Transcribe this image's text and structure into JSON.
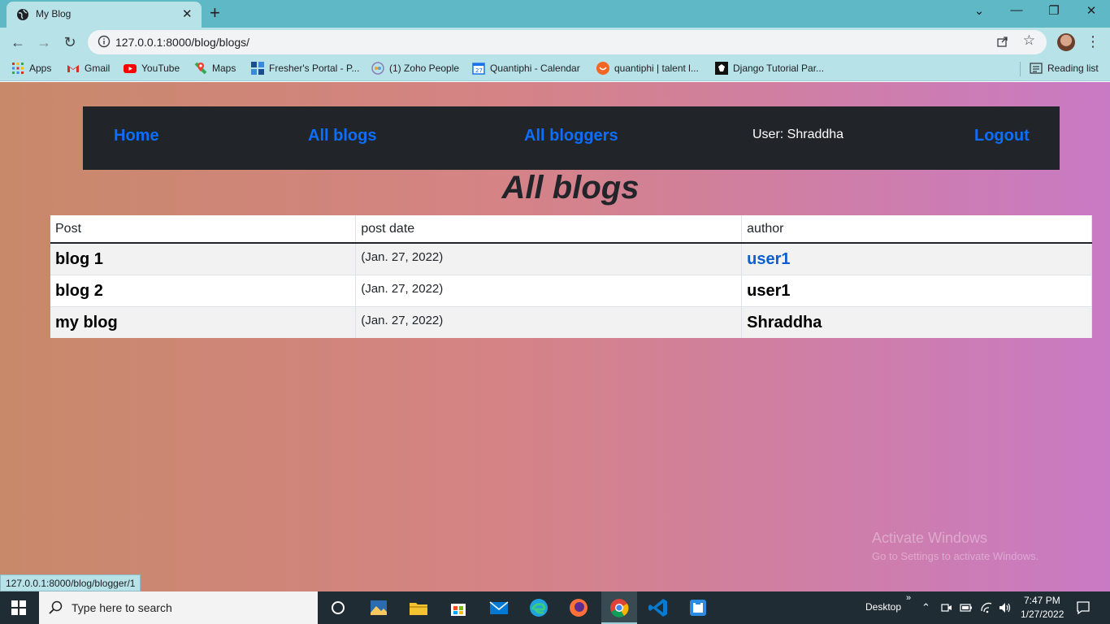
{
  "browser": {
    "tab_title": "My Blog",
    "tab_close": "✕",
    "new_tab": "+",
    "url": "127.0.0.1:8000/blog/blogs/",
    "window_controls": [
      "⌄",
      "—",
      "❐",
      "✕"
    ],
    "menu_dots": "⋮",
    "star": "☆"
  },
  "bookmarks": [
    {
      "label": "Apps",
      "icon": "apps-grid-icon"
    },
    {
      "label": "Gmail",
      "icon": "gmail-icon"
    },
    {
      "label": "YouTube",
      "icon": "youtube-icon"
    },
    {
      "label": "Maps",
      "icon": "maps-icon"
    },
    {
      "label": "Fresher's Portal - P...",
      "icon": "portal-icon"
    },
    {
      "label": "(1) Zoho People",
      "icon": "zoho-icon"
    },
    {
      "label": "Quantiphi - Calendar",
      "icon": "calendar-icon"
    },
    {
      "label": "quantiphi | talent l...",
      "icon": "talent-icon"
    },
    {
      "label": "Django Tutorial Par...",
      "icon": "django-icon"
    },
    {
      "label": "Reading list",
      "icon": "reading-list-icon"
    }
  ],
  "navbar": {
    "home": "Home",
    "all_blogs": "All blogs",
    "all_bloggers": "All bloggers",
    "user": "User: Shraddha",
    "logout": "Logout"
  },
  "page": {
    "title": "All blogs",
    "columns": [
      "Post",
      "post date",
      "author"
    ],
    "rows": [
      {
        "post": "blog 1",
        "date": "(Jan. 27, 2022)",
        "author": "user1",
        "author_link": true
      },
      {
        "post": "blog 2",
        "date": "(Jan. 27, 2022)",
        "author": "user1",
        "author_link": false
      },
      {
        "post": "my blog",
        "date": "(Jan. 27, 2022)",
        "author": "Shraddha",
        "author_link": false
      }
    ]
  },
  "watermark": {
    "line1": "Activate Windows",
    "line2": "Go to Settings to activate Windows."
  },
  "status_bar_url": "127.0.0.1:8000/blog/blogger/1",
  "taskbar": {
    "search_placeholder": "Type here to search",
    "desktop_label": "Desktop",
    "chevron": "»",
    "time": "7:47 PM",
    "date": "1/27/2022"
  },
  "colors": {
    "link": "#0d6efd",
    "navbar_bg": "#212529",
    "chrome_frame": "#5fb8c6",
    "chrome_toolbar": "#b7e2e8"
  }
}
